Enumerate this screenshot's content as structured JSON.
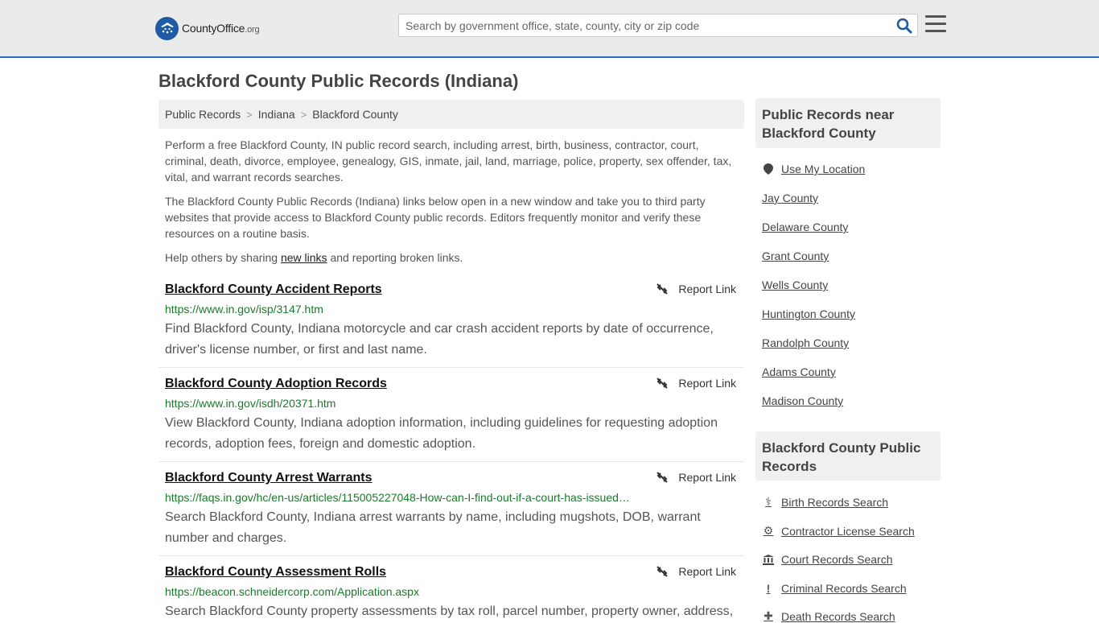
{
  "header": {
    "logo_main": "CountyOffice",
    "logo_org": ".org",
    "search_placeholder": "Search by government office, state, county, city or zip code"
  },
  "page_title": "Blackford County Public Records (Indiana)",
  "breadcrumb": [
    "Public Records",
    "Indiana",
    "Blackford County"
  ],
  "intro": {
    "p1": "Perform a free Blackford County, IN public record search, including arrest, birth, business, contractor, court, criminal, death, divorce, employee, genealogy, GIS, inmate, jail, land, marriage, police, property, sex offender, tax, vital, and warrant records searches.",
    "p2": "The Blackford County Public Records (Indiana) links below open in a new window and take you to third party websites that provide access to Blackford County public records. Editors frequently monitor and verify these resources on a routine basis.",
    "p3_before": "Help others by sharing ",
    "p3_link": "new links",
    "p3_after": " and reporting broken links."
  },
  "report_label": "Report Link",
  "records": [
    {
      "title": "Blackford County Accident Reports",
      "url": "https://www.in.gov/isp/3147.htm",
      "desc": "Find Blackford County, Indiana motorcycle and car crash accident reports by date of occurrence, driver's license number, or first and last name."
    },
    {
      "title": "Blackford County Adoption Records",
      "url": "https://www.in.gov/isdh/20371.htm",
      "desc": "View Blackford County, Indiana adoption information, including guidelines for requesting adoption records, adoption fees, foreign and domestic adoption."
    },
    {
      "title": "Blackford County Arrest Warrants",
      "url": "https://faqs.in.gov/hc/en-us/articles/115005227048-How-can-I-find-out-if-a-court-has-issued…",
      "desc": "Search Blackford County, Indiana arrest warrants by name, including mugshots, DOB, warrant number and charges."
    },
    {
      "title": "Blackford County Assessment Rolls",
      "url": "https://beacon.schneidercorp.com/Application.aspx",
      "desc": "Search Blackford County property assessments by tax roll, parcel number, property owner, address,"
    }
  ],
  "sidebar": {
    "near_title": "Public Records near Blackford County",
    "use_location": "Use My Location",
    "near_links": [
      "Jay County",
      "Delaware County",
      "Grant County",
      "Wells County",
      "Huntington County",
      "Randolph County",
      "Adams County",
      "Madison County"
    ],
    "records_title": "Blackford County Public Records",
    "record_links": [
      {
        "label": "Birth Records Search",
        "icon": "baby-icon",
        "glyph": "⚕"
      },
      {
        "label": "Contractor License Search",
        "icon": "gear-icon",
        "glyph": "⚙"
      },
      {
        "label": "Court Records Search",
        "icon": "courthouse-icon",
        "glyph": "⌂"
      },
      {
        "label": "Criminal Records Search",
        "icon": "exclamation-icon",
        "glyph": "!"
      },
      {
        "label": "Death Records Search",
        "icon": "cross-icon",
        "glyph": "✚"
      }
    ]
  },
  "colors": {
    "accent": "#2a6ebb",
    "url_green": "#1a7a2c",
    "header_bg": "#ebebeb"
  }
}
